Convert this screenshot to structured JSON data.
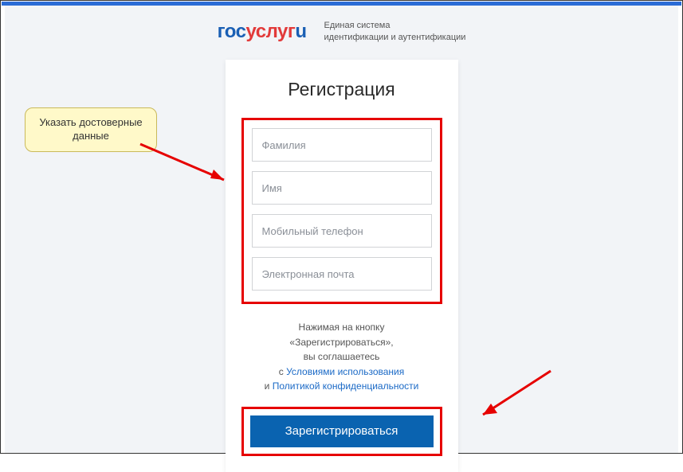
{
  "logo": {
    "part1": "гос",
    "part2": "услуг",
    "part3": "u"
  },
  "header_subtitle": {
    "line1": "Единая система",
    "line2": "идентификации и аутентификации"
  },
  "card": {
    "title": "Регистрация",
    "fields": {
      "surname": "Фамилия",
      "name": "Имя",
      "phone": "Мобильный телефон",
      "email": "Электронная почта"
    },
    "consent": {
      "line1": "Нажимая на кнопку",
      "line2": "«Зарегистрироваться»,",
      "line3": "вы соглашаетесь",
      "line4_pre": "с ",
      "line4_link": "Условиями использования",
      "line5_pre": "и ",
      "line5_link": "Политикой конфиденциальности"
    },
    "button": "Зарегистрироваться"
  },
  "callout": {
    "text": "Указать достоверные данные"
  }
}
